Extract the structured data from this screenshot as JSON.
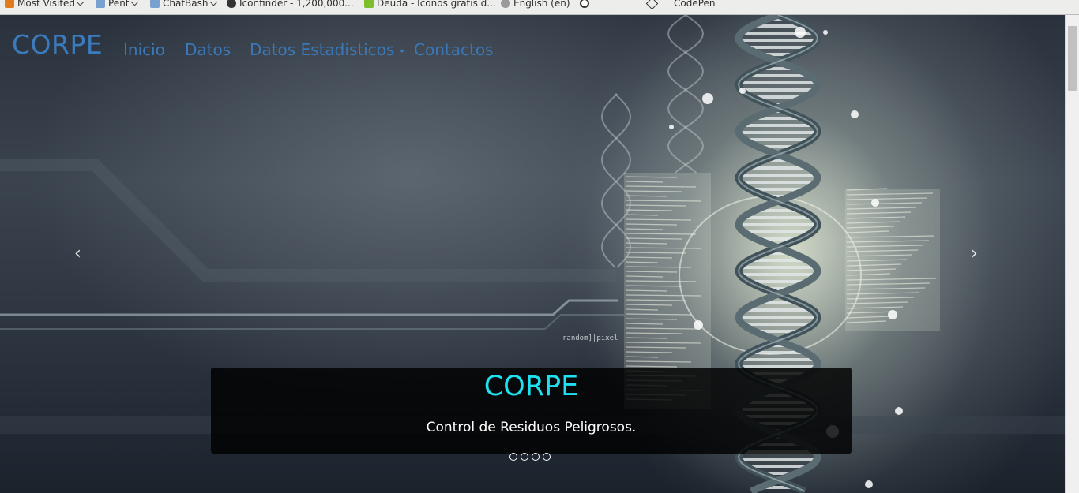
{
  "bookmarks": [
    {
      "label": "Most Visited",
      "icon": "most-visited-icon",
      "dropdown": true
    },
    {
      "label": "Pent",
      "icon": "folder-icon",
      "dropdown": true
    },
    {
      "label": "ChatBash",
      "icon": "folder-icon",
      "dropdown": true
    },
    {
      "label": "Iconfinder - 1,200,000...",
      "icon": "iconfinder-icon",
      "dropdown": false
    },
    {
      "label": "Deuda - Iconos gratis d...",
      "icon": "leaf-icon",
      "dropdown": false
    },
    {
      "label": "English (en)",
      "icon": "globe-icon",
      "dropdown": false
    },
    {
      "label": "",
      "icon": "circle-icon",
      "dropdown": false
    },
    {
      "label": "CodePen",
      "icon": "codepen-icon",
      "dropdown": false
    }
  ],
  "navbar": {
    "brand": "CORPE",
    "items": [
      "Inicio",
      "Datos",
      "Datos Estadisticos",
      "Contactos"
    ]
  },
  "carousel": {
    "prev_icon": "chevron-left-icon",
    "next_icon": "chevron-right-icon",
    "caption_title": "CORPE",
    "caption_text": "Control de Residuos Peligrosos.",
    "indicator_count": 4,
    "background_text": "random]|pixel"
  },
  "colors": {
    "brand": "#3b7bbd",
    "caption_title": "#1fe0f0"
  }
}
